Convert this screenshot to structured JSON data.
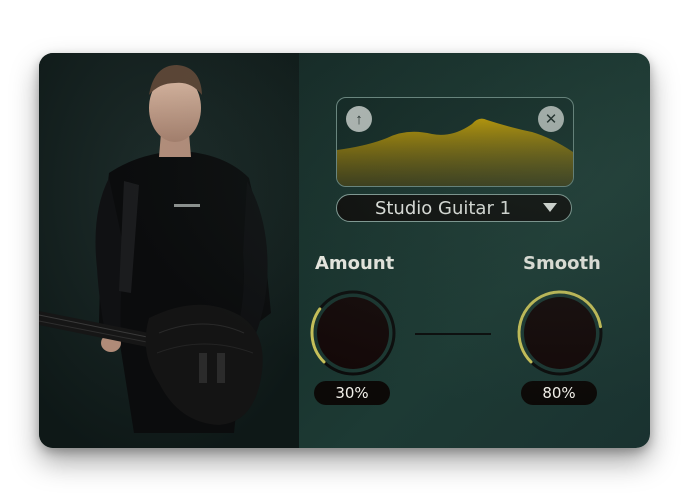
{
  "waveform": {
    "up_icon": "arrow-up-icon",
    "close_icon": "close-icon",
    "fill_color": "#c9a000",
    "up_glyph": "↑",
    "close_glyph": "✕"
  },
  "preset": {
    "label": "Studio Guitar 1",
    "caret_icon": "caret-down-icon"
  },
  "knobs": {
    "amount": {
      "title": "Amount",
      "value_label": "30%",
      "value": 0.3
    },
    "smooth": {
      "title": "Smooth",
      "value_label": "80%",
      "value": 0.8
    }
  },
  "colors": {
    "accent": "#c8c25a",
    "knob_body": "#140808",
    "background": "#17302b"
  }
}
